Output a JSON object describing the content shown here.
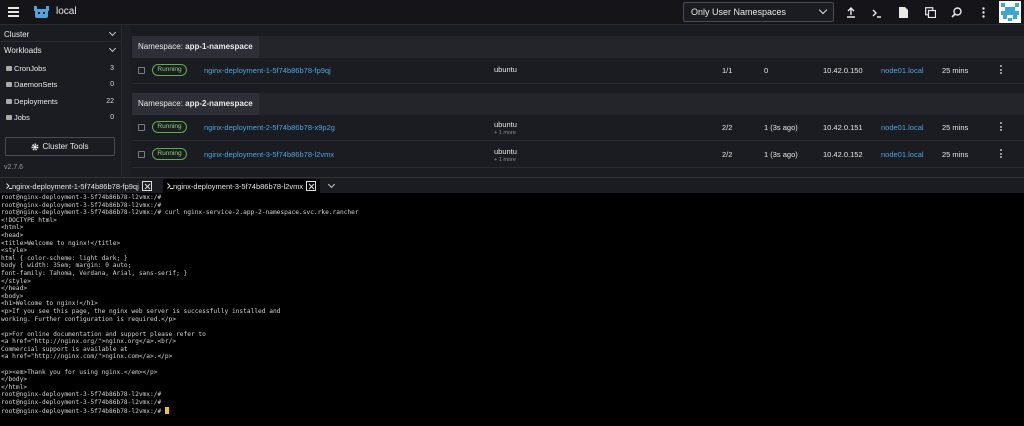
{
  "header": {
    "cluster_name": "local",
    "namespace_filter": "Only User Namespaces"
  },
  "sidebar": {
    "groups": [
      "Cluster",
      "Workloads"
    ],
    "items": [
      {
        "label": "CronJobs",
        "count": "3"
      },
      {
        "label": "DaemonSets",
        "count": "0"
      },
      {
        "label": "Deployments",
        "count": "22"
      },
      {
        "label": "Jobs",
        "count": "0"
      }
    ],
    "cluster_tools_label": "Cluster Tools",
    "version": "v2.7.6"
  },
  "namespaces": [
    {
      "prefix": "Namespace:",
      "name": "app-1-namespace"
    },
    {
      "prefix": "Namespace:",
      "name": "app-2-namespace"
    }
  ],
  "pods": [
    {
      "state": "Running",
      "name": "nginx-deployment-1-5f74b86b78-fp9qj",
      "image": "ubuntu",
      "image_more": "",
      "ready": "1/1",
      "restarts": "0",
      "ip": "10.42.0.150",
      "node": "node01.local",
      "age": "25 mins"
    },
    {
      "state": "Running",
      "name": "nginx-deployment-2-5f74b86b78-x9p2g",
      "image": "ubuntu",
      "image_more": "+ 1 more",
      "ready": "2/2",
      "restarts": "1 (3s ago)",
      "ip": "10.42.0.151",
      "node": "node01.local",
      "age": "25 mins"
    },
    {
      "state": "Running",
      "name": "nginx-deployment-3-5f74b86b78-l2vmx",
      "image": "ubuntu",
      "image_more": "+ 1 more",
      "ready": "2/2",
      "restarts": "1 (3s ago)",
      "ip": "10.42.0.152",
      "node": "node01.local",
      "age": "25 mins"
    }
  ],
  "terminal_tabs": [
    {
      "label": "nginx-deployment-1-5f74b86b78-fp9qj"
    },
    {
      "label": "nginx-deployment-3-5f74b86b78-l2vmx"
    }
  ],
  "terminal": {
    "output": "root@nginx-deployment-3-5f74b86b78-l2vmx:/#\nroot@nginx-deployment-3-5f74b86b78-l2vmx:/#\nroot@nginx-deployment-3-5f74b86b78-l2vmx:/# curl nginx-service-2.app-2-namespace.svc.rke.rancher\n<!DOCTYPE html>\n<html>\n<head>\n<title>Welcome to nginx!</title>\n<style>\nhtml { color-scheme: light dark; }\nbody { width: 35em; margin: 0 auto;\nfont-family: Tahoma, Verdana, Arial, sans-serif; }\n</style>\n</head>\n<body>\n<h1>Welcome to nginx!</h1>\n<p>If you see this page, the nginx web server is successfully installed and\nworking. Further configuration is required.</p>\n\n<p>For online documentation and support please refer to\n<a href=\"http://nginx.org/\">nginx.org</a>.<br/>\nCommercial support is available at\n<a href=\"http://nginx.com/\">nginx.com</a>.</p>\n\n<p><em>Thank you for using nginx.</em></p>\n</body>\n</html>\nroot@nginx-deployment-3-5f74b86b78-l2vmx:/#\nroot@nginx-deployment-3-5f74b86b78-l2vmx:/#\nroot@nginx-deployment-3-5f74b86b78-l2vmx:/# "
  },
  "colors": {
    "accent_link": "#4ba6e0",
    "running_green": "#8fd17a",
    "cursor": "#f1c40f"
  }
}
